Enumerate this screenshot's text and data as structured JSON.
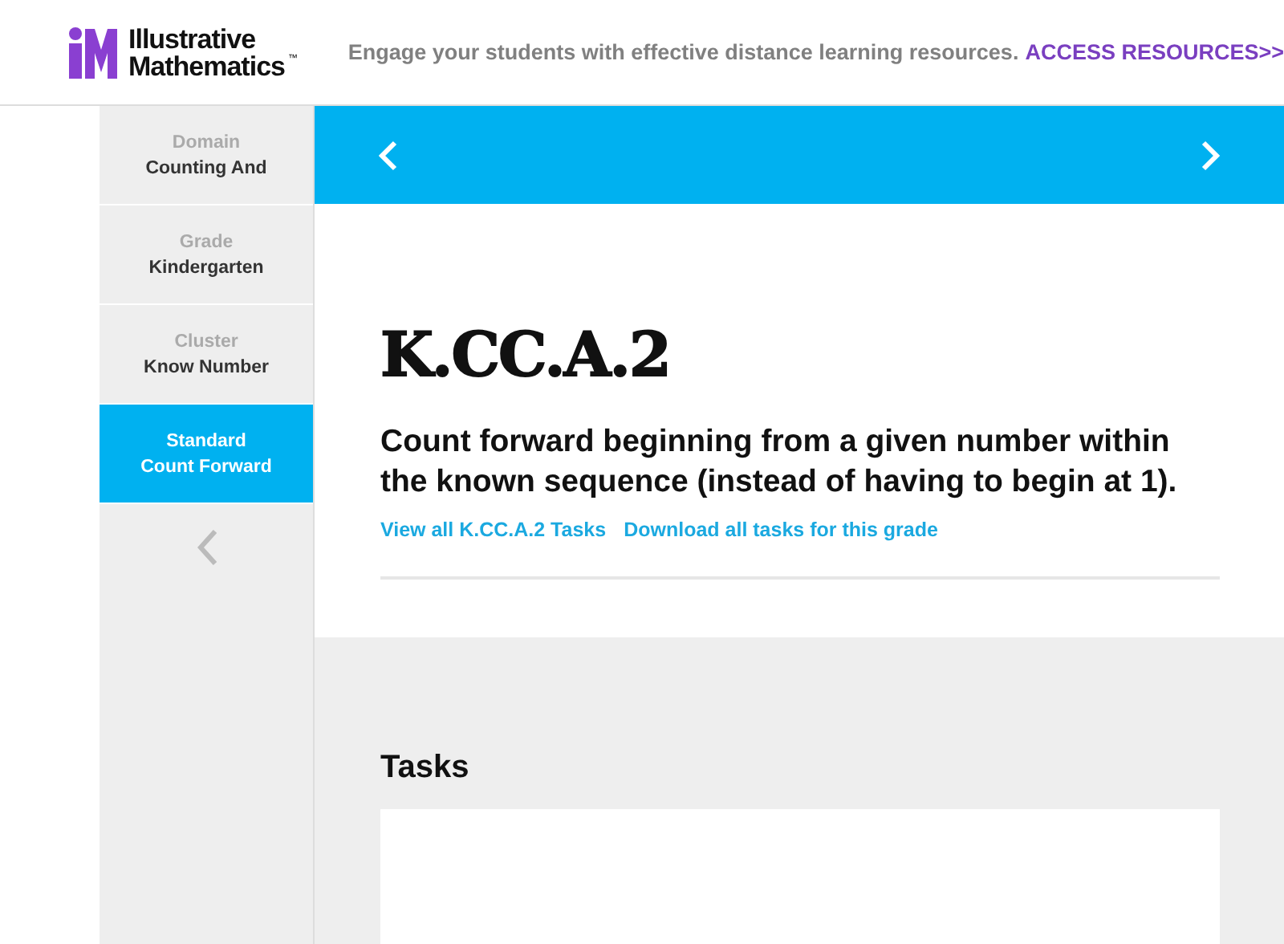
{
  "header": {
    "logo_lines": [
      "Illustrative",
      "Mathematics"
    ],
    "trademark": "™",
    "promo": "Engage your students with effective distance learning resources.",
    "promo_link": "ACCESS RESOURCES>>"
  },
  "sidebar": {
    "items": [
      {
        "label": "Domain",
        "value": "Counting And",
        "selected": false
      },
      {
        "label": "Grade",
        "value": "Kindergarten",
        "selected": false
      },
      {
        "label": "Cluster",
        "value": "Know Number",
        "selected": false
      },
      {
        "label": "Standard",
        "value": "Count Forward",
        "selected": true
      }
    ]
  },
  "standard": {
    "code": "K.CC.A.2",
    "description": "Count forward beginning from a given number within the known sequence (instead of having to begin at 1).",
    "links": [
      "View all K.CC.A.2 Tasks",
      "Download all tasks for this grade"
    ]
  },
  "tasks": {
    "heading": "Tasks"
  }
}
